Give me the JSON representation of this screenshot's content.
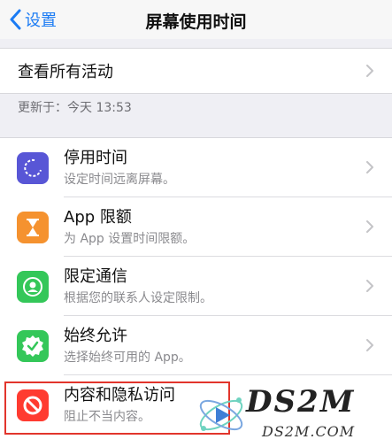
{
  "nav": {
    "back_label": "设置",
    "title": "屏幕使用时间"
  },
  "activity": {
    "label": "查看所有活动"
  },
  "updated_text": "更新于：今天 13:53",
  "rows": [
    {
      "title": "停用时间",
      "subtitle": "设定时间远离屏幕。",
      "icon": "downtime-icon",
      "color": "#5856d6"
    },
    {
      "title": "App 限额",
      "subtitle": "为 App 设置时间限额。",
      "icon": "hourglass-icon",
      "color": "#f5922f"
    },
    {
      "title": "限定通信",
      "subtitle": "根据您的联系人设定限制。",
      "icon": "contact-icon",
      "color": "#34c759"
    },
    {
      "title": "始终允许",
      "subtitle": "选择始终可用的 App。",
      "icon": "checkmark-badge-icon",
      "color": "#34c759"
    },
    {
      "title": "内容和隐私访问",
      "subtitle": "阻止不当内容。",
      "icon": "block-icon",
      "color": "#ff3b30"
    }
  ],
  "watermark": {
    "main": "DS2M",
    "sub": "DS2M.COM"
  }
}
